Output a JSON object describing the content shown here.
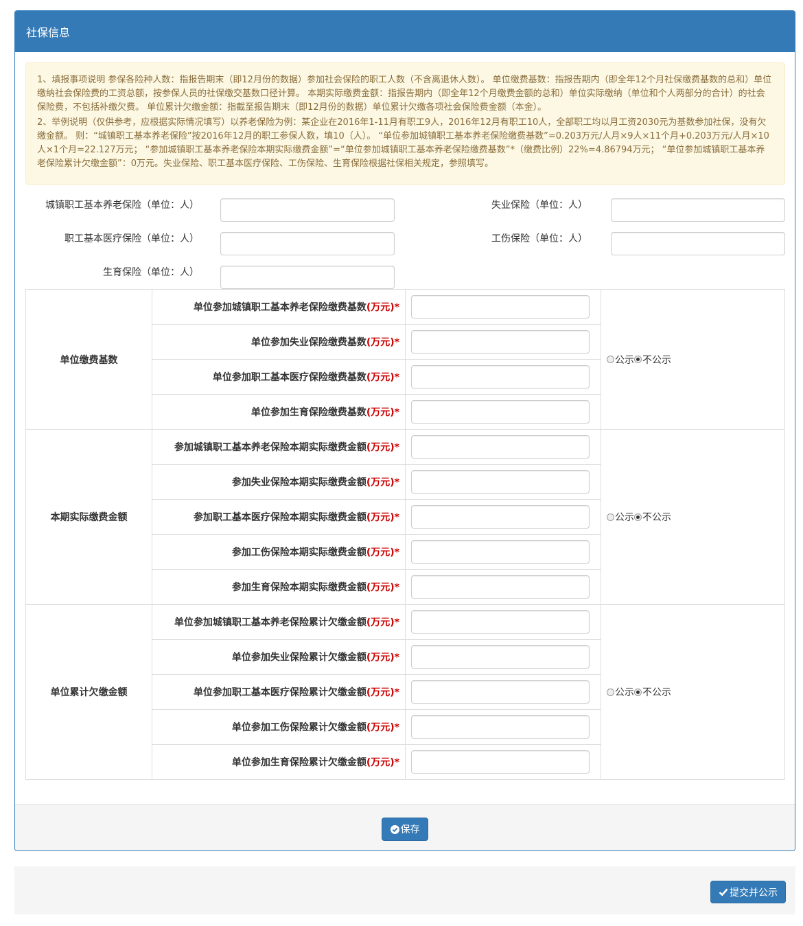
{
  "panel": {
    "title": "社保信息",
    "notice": [
      "1、填报事项说明 参保各险种人数：指报告期末（即12月份的数据）参加社会保险的职工人数（不含离退休人数）。 单位缴费基数：指报告期内（即全年12个月社保缴费基数的总和）单位缴纳社会保险费的工资总额，按参保人员的社保缴交基数口径计算。 本期实际缴费金额：指报告期内（即全年12个月缴费金额的总和）单位实际缴纳（单位和个人两部分的合计）的社会保险费，不包括补缴欠费。 单位累计欠缴金额：指截至报告期末（即12月份的数据）单位累计欠缴各项社会保险费金额（本金）。",
      "2、举例说明（仅供参考，应根据实际情况填写）以养老保险为例：某企业在2016年1-11月有职工9人，2016年12月有职工10人，全部职工均以月工资2030元为基数参加社保，没有欠缴金额。 则：“城镇职工基本养老保险”按2016年12月的职工参保人数，填10（人）。 “单位参加城镇职工基本养老保险缴费基数”=0.203万元/人月×9人×11个月+0.203万元/人月×10人×1个月=22.127万元； “参加城镇职工基本养老保险本期实际缴费金额”=“单位参加城镇职工基本养老保险缴费基数”*（缴费比例）22%=4.86794万元； “单位参加城镇职工基本养老保险累计欠缴金额”：0万元。失业保险、职工基本医疗保险、工伤保险、生育保险根据社保相关规定，参照填写。"
    ],
    "headcount": {
      "pension_label": "城镇职工基本养老保险（单位：人）",
      "unemployment_label": "失业保险（单位：人）",
      "medical_label": "职工基本医疗保险（单位：人）",
      "injury_label": "工伤保险（单位：人）",
      "maternity_label": "生育保险（单位：人）"
    },
    "groups": [
      {
        "title": "单位缴费基数",
        "rows": [
          "单位参加城镇职工基本养老保险缴费基数",
          "单位参加失业保险缴费基数",
          "单位参加职工基本医疗保险缴费基数",
          "单位参加生育保险缴费基数"
        ]
      },
      {
        "title": "本期实际缴费金额",
        "rows": [
          "参加城镇职工基本养老保险本期实际缴费金额",
          "参加失业保险本期实际缴费金额",
          "参加职工基本医疗保险本期实际缴费金额",
          "参加工伤保险本期实际缴费金额",
          "参加生育保险本期实际缴费金额"
        ]
      },
      {
        "title": "单位累计欠缴金额",
        "rows": [
          "单位参加城镇职工基本养老保险累计欠缴金额",
          "单位参加失业保险累计欠缴金额",
          "单位参加职工基本医疗保险累计欠缴金额",
          "单位参加工伤保险累计欠缴金额",
          "单位参加生育保险累计欠缴金额"
        ]
      }
    ],
    "unit": "(万元)",
    "required_mark": "*",
    "public_label": "公示",
    "private_label": "不公示",
    "selected": "不公示",
    "save_label": "保存"
  },
  "footer": {
    "submit_label": "提交并公示"
  },
  "colors": {
    "primary": "#337ab7",
    "notice_bg": "#fcf8e3",
    "notice_text": "#8a6d3b",
    "required": "#cc0000"
  },
  "icons": {
    "save": "check-circle-icon",
    "submit": "check-icon"
  }
}
